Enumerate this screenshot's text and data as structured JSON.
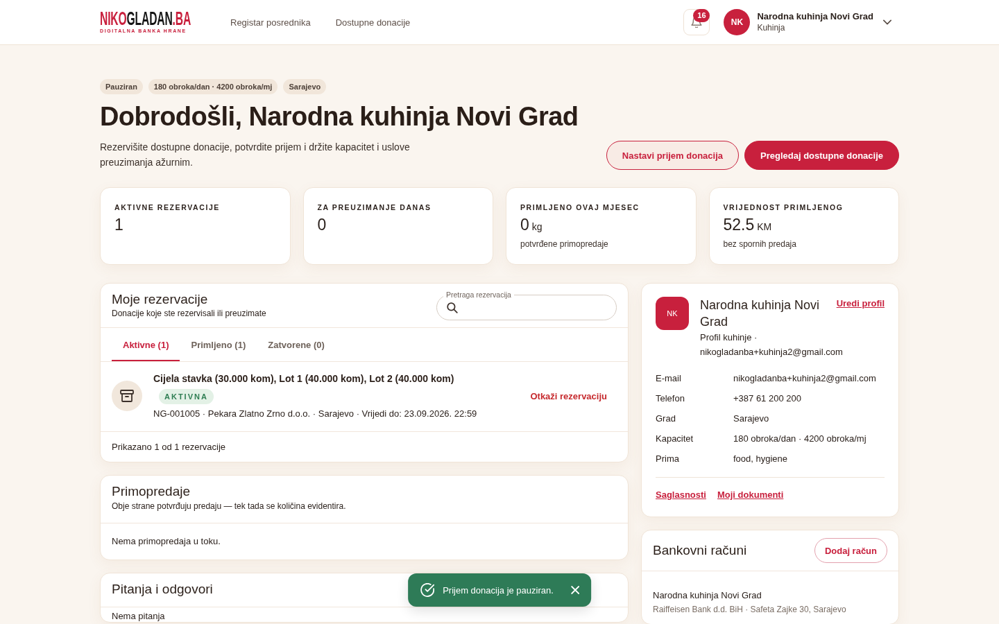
{
  "header": {
    "logo": {
      "parts": [
        {
          "text": "NIKO",
          "accent": true
        },
        {
          "text": "GLADAN",
          "accent": false
        },
        {
          "text": ".BA",
          "accent": true
        }
      ],
      "tagline": "DIGITALNA BANKA HRANE"
    },
    "nav": [
      {
        "label": "Registar posrednika"
      },
      {
        "label": "Dostupne donacije"
      }
    ],
    "notifications": {
      "count": "16"
    },
    "user": {
      "initials": "NK",
      "name": "Narodna kuhinja Novi Grad",
      "role": "Kuhinja"
    }
  },
  "hero": {
    "chips": [
      "Pauziran",
      "180 obroka/dan · 4200 obroka/mj",
      "Sarajevo"
    ],
    "title": "Dobrodošli, Narodna kuhinja Novi Grad",
    "subtitle": "Rezervišite dostupne donacije, potvrdite prijem i držite kapacitet i uslove preuzimanja ažurnim.",
    "buttons": [
      {
        "label": "Nastavi prijem donacija",
        "kind": "secondary"
      },
      {
        "label": "Pregledaj dostupne donacije",
        "kind": "primary"
      }
    ]
  },
  "stats": [
    {
      "label": "AKTIVNE REZERVACIJE",
      "value": "1"
    },
    {
      "label": "ZA PREUZIMANJE DANAS",
      "value": "0"
    },
    {
      "label": "PRIMLJENO OVAJ MJESEC",
      "value": "0",
      "unit": "kg",
      "note": "potvrđene primopredaje"
    },
    {
      "label": "VRIJEDNOST PRIMLJENOG",
      "value": "52.5",
      "unit": "KM",
      "note": "bez spornih predaja"
    }
  ],
  "reservations": {
    "title": "Moje rezervacije",
    "subtitle": "Donacije koje ste rezervisali ili preuzimate",
    "search": {
      "label": "Pretraga rezervacija"
    },
    "tabs": [
      {
        "label": "Aktivne (1)",
        "selected": true
      },
      {
        "label": "Primljeno (1)",
        "selected": false
      },
      {
        "label": "Zatvorene (0)",
        "selected": false
      }
    ],
    "items": [
      {
        "title": "Cijela stavka (30.000 kom), Lot 1 (40.000 kom), Lot 2 (40.000 kom)",
        "status": {
          "label": "AKTIVNA",
          "kind": "active"
        },
        "details": "NG-001005 · Pekara Zlatno Zrno d.o.o. · Sarajevo · Vrijedi do: 23.09.2026. 22:59",
        "action": "Otkaži rezervaciju"
      }
    ],
    "footer": "Prikazano 1 od 1 rezervacije"
  },
  "handovers": {
    "title": "Primopredaje",
    "subtitle": "Obje strane potvrđuju predaju — tek tada se količina evidentira.",
    "empty": "Nema primopredaja u toku."
  },
  "questions": {
    "title": "Pitanja i odgovori",
    "empty": "Nema pitanja"
  },
  "profile": {
    "initials": "NK",
    "name": "Narodna kuhinja Novi Grad",
    "edit_link": "Uredi profil",
    "description": "Profil kuhinje · nikogladanba+kuhinja2@gmail.com",
    "details": [
      {
        "label": "E-mail",
        "value": "nikogladanba+kuhinja2@gmail.com"
      },
      {
        "label": "Telefon",
        "value": "+387 61 200 200"
      },
      {
        "label": "Grad",
        "value": "Sarajevo"
      },
      {
        "label": "Kapacitet",
        "value": "180 obroka/dan · 4200 obroka/mj"
      },
      {
        "label": "Prima",
        "value": "food, hygiene"
      }
    ],
    "links": [
      "Saglasnosti",
      "Moji dokumenti"
    ]
  },
  "bank_accounts": {
    "title": "Bankovni računi",
    "add_button": "Dodaj račun",
    "accounts": [
      {
        "holder": "Narodna kuhinja Novi Grad",
        "bank": "Raiffeisen Bank d.d. BiH · Safeta Zajke 30, Sarajevo"
      }
    ]
  },
  "toast": {
    "message": "Prijem donacija je pauziran."
  }
}
